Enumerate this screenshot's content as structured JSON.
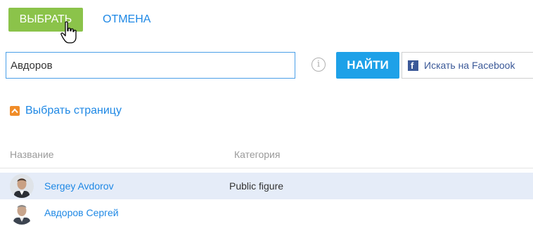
{
  "toolbar": {
    "select_label": "ВЫБРАТЬ",
    "cancel_label": "ОТМЕНА"
  },
  "search": {
    "value": "Авдоров",
    "info_glyph": "i",
    "find_label": "НАЙТИ",
    "facebook_label": "Искать на Facebook"
  },
  "choose_page": {
    "label": "Выбрать страницу"
  },
  "table": {
    "columns": [
      "Название",
      "Категория"
    ],
    "rows": [
      {
        "name": "Sergey Avdorov",
        "category": "Public figure",
        "selected": true
      },
      {
        "name": "Авдоров Сергей",
        "category": "",
        "selected": false
      }
    ]
  },
  "colors": {
    "select_button": "#8bc34a",
    "find_button": "#1ea1e8",
    "link": "#1e88e5",
    "facebook": "#3b5998",
    "chevron": "#f08c28",
    "selected_row": "#e5ecf8"
  },
  "icons": [
    "hand-cursor-icon",
    "info-icon",
    "facebook-icon",
    "chevron-up-icon",
    "avatar"
  ]
}
